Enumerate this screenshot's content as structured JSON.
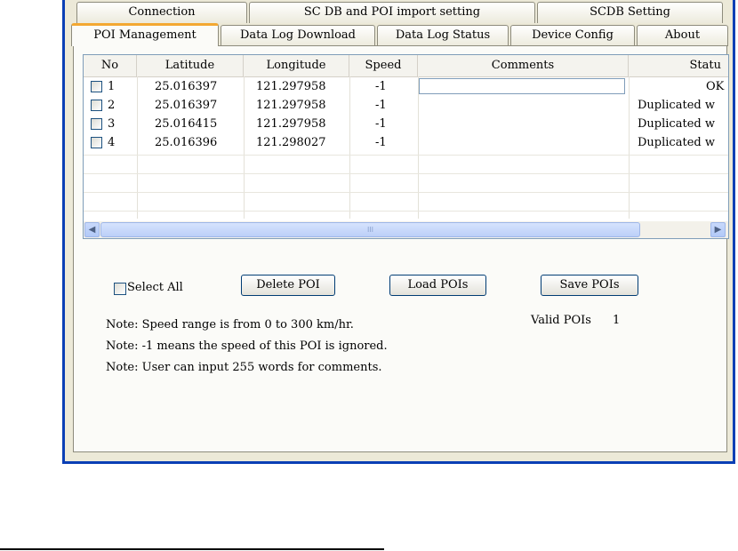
{
  "tabs_top": [
    "Connection",
    "SC DB and POI import setting",
    "SCDB  Setting"
  ],
  "tabs_bottom": [
    "POI Management",
    "Data Log Download",
    "Data Log Status",
    "Device Config",
    "About"
  ],
  "active_tab": "POI Management",
  "table": {
    "columns": [
      "No",
      "Latitude",
      "Longitude",
      "Speed",
      "Comments",
      "Statu"
    ],
    "rows": [
      {
        "no": "1",
        "lat": "25.016397",
        "lon": "121.297958",
        "speed": "-1",
        "comments": "",
        "status": "OK",
        "checked": false
      },
      {
        "no": "2",
        "lat": "25.016397",
        "lon": "121.297958",
        "speed": "-1",
        "comments": "",
        "status": "Duplicated w",
        "checked": false
      },
      {
        "no": "3",
        "lat": "25.016415",
        "lon": "121.297958",
        "speed": "-1",
        "comments": "",
        "status": "Duplicated w",
        "checked": false
      },
      {
        "no": "4",
        "lat": "25.016396",
        "lon": "121.298027",
        "speed": "-1",
        "comments": "",
        "status": "Duplicated w",
        "checked": false
      }
    ]
  },
  "controls": {
    "select_all_label": "Select All",
    "delete_label": "Delete POI",
    "load_label": "Load POIs",
    "save_label": "Save POIs",
    "valid_pois_label": "Valid POIs",
    "valid_pois_count": "1"
  },
  "notes": [
    "Note: Speed range is from 0 to 300 km/hr.",
    "Note: -1 means the speed of this POI is ignored.",
    "Note:  User can input 255 words for comments."
  ],
  "scroll": {
    "left_icon": "scroll-left-arrow",
    "right_icon": "scroll-right-arrow",
    "grip": "III"
  }
}
